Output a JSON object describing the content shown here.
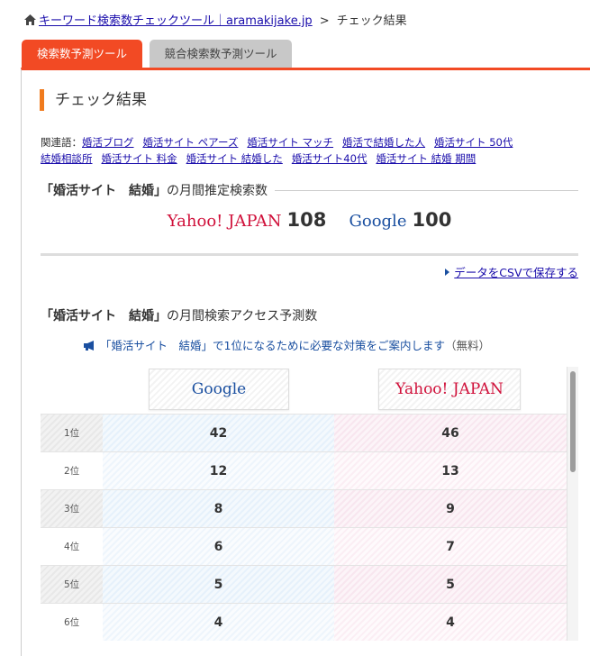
{
  "breadcrumb": {
    "home_label": "キーワード検索数チェックツール｜aramakijake.jp",
    "separator": ">",
    "current": "チェック結果"
  },
  "tabs": [
    {
      "label": "検索数予測ツール",
      "active": true
    },
    {
      "label": "競合検索数予測ツール",
      "active": false
    }
  ],
  "section_title": "チェック結果",
  "related": {
    "prefix": "関連語：",
    "links": [
      "婚活ブログ",
      "婚活サイト ペアーズ",
      "婚活サイト マッチ",
      "婚活で結婚した人",
      "婚活サイト 50代",
      "結婚相談所",
      "婚活サイト 料金",
      "婚活サイト 結婚した",
      "婚活サイト40代",
      "婚活サイト 結婚 期間"
    ]
  },
  "estimate": {
    "keyword_open": "「",
    "keyword": "婚活サイト　結婚",
    "keyword_close": "」",
    "suffix": "の月間推定検索数",
    "yahoo_label": "Yahoo! JAPAN",
    "yahoo_value": "108",
    "google_label": "Google",
    "google_value": "100"
  },
  "csv_link": "データをCSVで保存する",
  "access": {
    "keyword_open": "「",
    "keyword": "婚活サイト　結婚",
    "keyword_close": "」",
    "suffix": "の月間検索アクセス予測数"
  },
  "notice": {
    "text": "「婚活サイト　結婚」で1位になるために必要な対策をご案内します",
    "paren": "（無料）"
  },
  "table": {
    "google_header": "Google",
    "yahoo_header": "Yahoo! JAPAN",
    "rows": [
      {
        "rank": "1位",
        "google": "42",
        "yahoo": "46"
      },
      {
        "rank": "2位",
        "google": "12",
        "yahoo": "13"
      },
      {
        "rank": "3位",
        "google": "8",
        "yahoo": "9"
      },
      {
        "rank": "4位",
        "google": "6",
        "yahoo": "7"
      },
      {
        "rank": "5位",
        "google": "5",
        "yahoo": "5"
      },
      {
        "rank": "6位",
        "google": "4",
        "yahoo": "4"
      }
    ]
  },
  "colors": {
    "accent": "#f24a24",
    "title_bar": "#f07b1e",
    "link": "#1a0dab",
    "yahoo": "#d0103a",
    "google": "#1a4fa0"
  }
}
